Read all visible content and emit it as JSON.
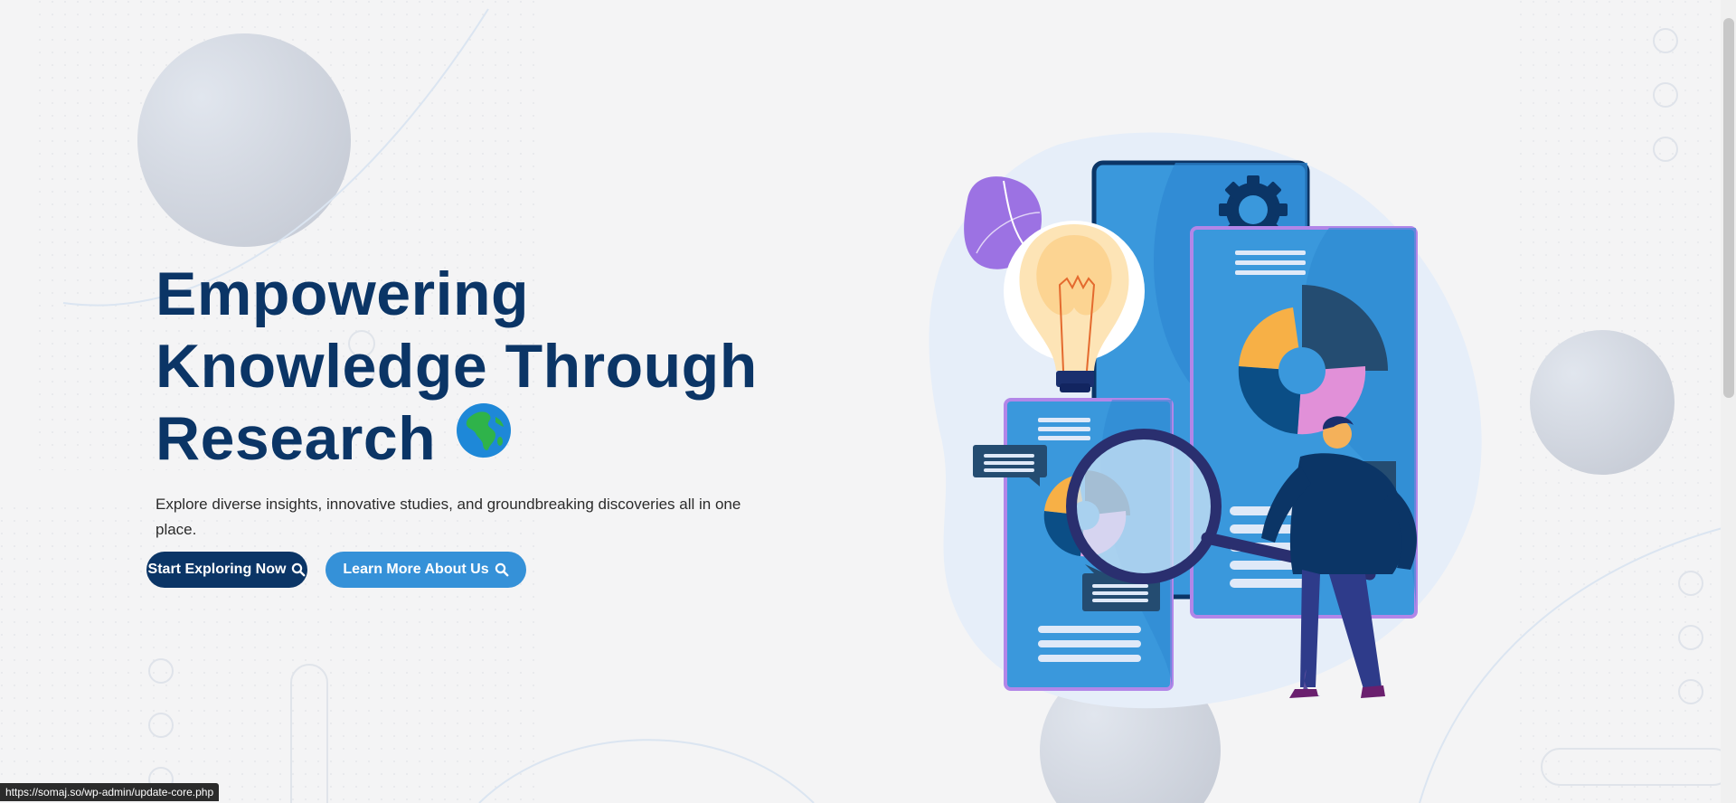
{
  "hero": {
    "headline_line1": "Empowering",
    "headline_line2": "Knowledge Through",
    "headline_line3": "Research",
    "globe_icon": "globe-africa-icon",
    "subtitle": "Explore diverse insights, innovative studies, and groundbreaking discoveries all in one place."
  },
  "buttons": {
    "start_label": "Start Exploring Now",
    "learn_label": "Learn More About Us",
    "icon": "search-icon"
  },
  "status_bar": {
    "url": "https://somaj.so/wp-admin/update-core.php"
  },
  "colors": {
    "heading": "#0b3566",
    "primary_button": "#0b3566",
    "secondary_button": "#3591d8",
    "background": "#f4f4f5"
  }
}
